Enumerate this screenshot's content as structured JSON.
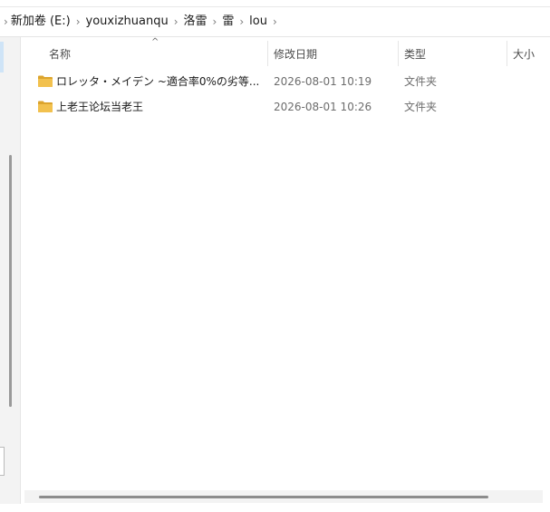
{
  "breadcrumb": {
    "items": [
      "新加卷 (E:)",
      "youxizhuanqu",
      "洛雷",
      "雷",
      "lou"
    ],
    "separator": "›"
  },
  "columns": {
    "name": "名称",
    "date": "修改日期",
    "type": "类型",
    "size": "大小",
    "sort_indicator": "^"
  },
  "files": [
    {
      "icon": "folder-icon",
      "name": "ロレッタ・メイデン ~適合率0%の劣等...",
      "date": "2026-08-01 10:19",
      "type": "文件夹"
    },
    {
      "icon": "folder-icon",
      "name": "上老王论坛当老王",
      "date": "2026-08-01 10:26",
      "type": "文件夹"
    }
  ],
  "colors": {
    "folder": "#f2c14e",
    "folder_dark": "#dca42d",
    "selection": "#cfe4f7"
  }
}
